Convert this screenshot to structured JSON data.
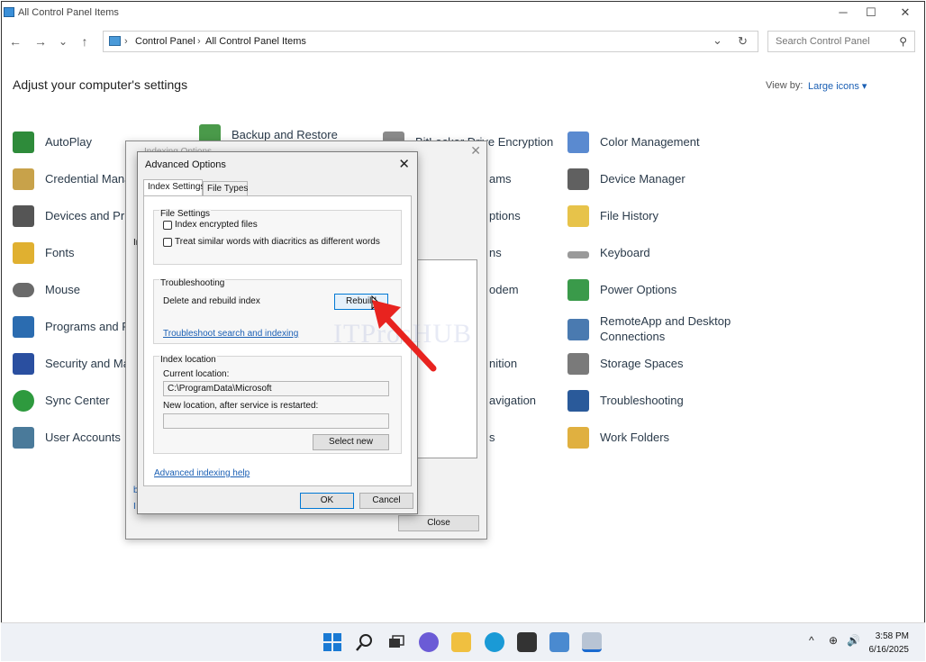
{
  "window": {
    "title": "All Control Panel Items",
    "minimize": "─",
    "maximize": "☐",
    "close": "✕"
  },
  "nav": {
    "back": "←",
    "forward": "→",
    "recent": "⌄",
    "up": "↑"
  },
  "address": {
    "sep1": "›",
    "crumb1": "Control Panel",
    "sep2": "›",
    "crumb2": "All Control Panel Items",
    "dropdown": "⌄",
    "refresh": "↻"
  },
  "search": {
    "placeholder": "Search Control Panel"
  },
  "heading": "Adjust your computer's settings",
  "view_by": {
    "label": "View by:",
    "value": "Large icons ▾"
  },
  "items": {
    "autoplay": "AutoPlay",
    "backup": "Backup and Restore",
    "bitlocker": "BitLocker Drive Encryption",
    "color": "Color Management",
    "credential": "Credential Mana",
    "programs_partial": "ams",
    "device_manager": "Device Manager",
    "devices": "Devices and Prir",
    "options_partial": "ptions",
    "file_history": "File History",
    "fonts": "Fonts",
    "ns_partial": "ns",
    "keyboard": "Keyboard",
    "mouse": "Mouse",
    "odem_partial": "odem",
    "power": "Power Options",
    "programs": "Programs and F",
    "remoteapp_1": "RemoteApp and Desktop",
    "remoteapp_2": "Connections",
    "security": "Security and Ma",
    "nition_partial": "nition",
    "storage": "Storage Spaces",
    "sync": "Sync Center",
    "navigation_partial": "avigation",
    "troubleshooting": "Troubleshooting",
    "user_accounts": "User Accounts",
    "s_partial": "s",
    "work_folders": "Work Folders"
  },
  "indexing": {
    "title": "Indexing Options",
    "close_label": "Close",
    "partial_i": "In",
    "partial_b": "b",
    "partial_t": "I"
  },
  "advanced": {
    "title": "Advanced Options",
    "close": "✕",
    "tabs": [
      "Index Settings",
      "File Types"
    ],
    "file_settings": {
      "label": "File Settings",
      "encrypted": "Index encrypted files",
      "diacritics": "Treat similar words with diacritics as different words"
    },
    "troubleshooting": {
      "label": "Troubleshooting",
      "rebuild_text": "Delete and rebuild index",
      "rebuild_button": "Rebuild",
      "troubleshoot_link": "Troubleshoot search and indexing"
    },
    "index_location": {
      "label": "Index location",
      "current_label": "Current location:",
      "current_value": "C:\\ProgramData\\Microsoft",
      "new_label": "New location, after service is restarted:",
      "new_value": "",
      "select_new": "Select new"
    },
    "help_link": "Advanced indexing help",
    "ok": "OK",
    "cancel": "Cancel"
  },
  "watermark": "ITProsHUB",
  "taskbar": {
    "time": "3:58 PM",
    "date": "6/16/2025",
    "chevron": "^",
    "network": "⊕",
    "volume": "🔊"
  },
  "colors": {
    "accent": "#1a5fb4",
    "arrow": "#e8231f"
  }
}
